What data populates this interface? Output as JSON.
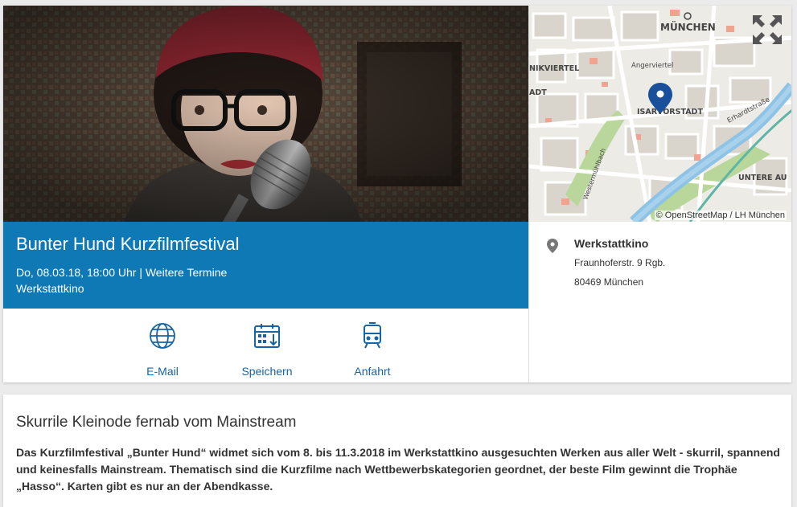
{
  "event": {
    "title": "Bunter Hund Kurzfilmfestival",
    "date_line": "Do, 08.03.18, 18:00 Uhr | Weitere Termine",
    "venue": "Werkstattkino"
  },
  "actions": [
    {
      "label": "E-Mail",
      "icon": "globe-icon"
    },
    {
      "label": "Speichern",
      "icon": "calendar-download-icon"
    },
    {
      "label": "Anfahrt",
      "icon": "tram-icon"
    }
  ],
  "map": {
    "city_label": "MÜNCHEN",
    "labels": [
      "NIKVIERTEL",
      "Angerviertel",
      "ADT",
      "ISARVORSTADT",
      "Erhardtstraße",
      "Westermühlbach",
      "UNTERE AU"
    ],
    "credit": "© OpenStreetMap / LH München"
  },
  "address": {
    "name": "Werkstattkino",
    "street": "Fraunhoferstr. 9 Rgb.",
    "city": "80469 München"
  },
  "description": {
    "heading": "Skurrile Kleinode fernab vom Mainstream",
    "body": "Das Kurzfilmfestival „Bunter Hund“ widmet sich vom 8. bis 11.3.2018 im Werkstattkino ausgesuchten Werken aus aller Welt - skurril, spannend und keinesfalls Mainstream. Thematisch sind die Kurzfilme nach Wettbewerbskategorien geordnet, der beste Film gewinnt die Trophäe „Hasso“. Karten gibt es nur an der Abendkasse."
  },
  "colors": {
    "banner": "#0f79b6",
    "link": "#1565a6",
    "map_pin": "#1a4f9c"
  }
}
